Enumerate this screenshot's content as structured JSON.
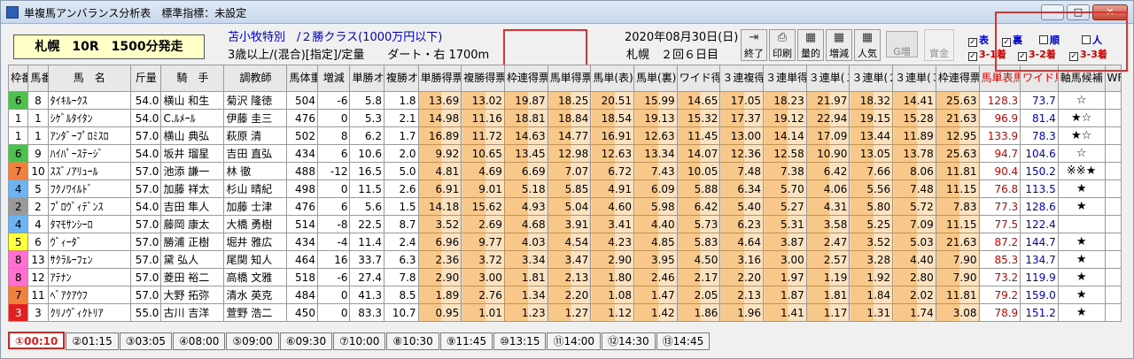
{
  "window": {
    "title": "単複馬アンバランス分析表　標準指標：未設定"
  },
  "race": {
    "box": "札幌　10R　1500分発走",
    "name": "苫小牧特別　/２勝クラス(1000万円以下)",
    "cond": "3歳以上/(混合)[指定]/定量　　ダート・右 1700m",
    "date": "2020年08月30日(日)",
    "venue": "札幌　２回６日目"
  },
  "toolbar": {
    "buttons": [
      {
        "label": "終了",
        "icon": "exit-icon"
      },
      {
        "label": "印刷",
        "icon": "printer-icon"
      },
      {
        "label": "量的",
        "icon": "table-icon"
      },
      {
        "label": "増減",
        "icon": "table-icon"
      },
      {
        "label": "人気",
        "icon": "table-icon"
      }
    ],
    "g_label": "G増",
    "pay_label": "實金"
  },
  "checks": [
    {
      "label": "表",
      "checked": true,
      "color": "blue"
    },
    {
      "label": "裏",
      "checked": true,
      "color": "blue"
    },
    {
      "label": "順",
      "checked": false,
      "color": "blue"
    },
    {
      "label": "人",
      "checked": false,
      "color": "blue"
    },
    {
      "label": "3-1着",
      "checked": true,
      "color": "red"
    },
    {
      "label": "3-2着",
      "checked": true,
      "color": "red"
    },
    {
      "label": "3-3着",
      "checked": true,
      "color": "red"
    }
  ],
  "headers": [
    "枠番",
    "馬番",
    "馬　名",
    "斤量",
    "騎　手",
    "調教師",
    "馬体重",
    "増減",
    "単勝オッズ",
    "複勝オッズ",
    "単勝得票率",
    "複勝得票率",
    "枠連得票率",
    "馬単得票率",
    "馬単(表)",
    "馬単(裏)",
    "ワイド得票率",
    "３連複得票率",
    "３連単得票率",
    "３連単(１着)",
    "３連単(２着)",
    "３連単(３着)",
    "枠連得票率",
    "馬単表馬単裏",
    "ワイド馬連",
    "軸馬候補",
    "WF"
  ],
  "rows": [
    {
      "waku": "6",
      "wc": "#4fbf4f",
      "ban": "8",
      "name": "ﾀｲｷﾙｰｸｽ",
      "kin": "54.0",
      "jockey": "横山 和生",
      "trainer": "菊沢 隆徳",
      "w": "504",
      "d": "-6",
      "o1": "5.8",
      "o2": "1.8",
      "v": [
        "13.69",
        "13.02",
        "19.87",
        "18.25",
        "20.51",
        "15.99",
        "14.65",
        "17.05",
        "18.23",
        "21.97",
        "18.32",
        "14.41",
        "25.63"
      ],
      "b1": "128.3",
      "b2": "73.7",
      "star": "☆"
    },
    {
      "waku": "1",
      "wc": "#ffffff",
      "ban": "1",
      "name": "ｼｹﾞﾙﾀｲﾀﾝ",
      "kin": "54.0",
      "jockey": "C.ﾙﾒｰﾙ",
      "trainer": "伊藤 圭三",
      "w": "476",
      "d": "0",
      "o1": "5.3",
      "o2": "2.1",
      "v": [
        "14.98",
        "11.16",
        "18.81",
        "18.84",
        "18.54",
        "19.13",
        "15.32",
        "17.37",
        "19.12",
        "22.94",
        "19.15",
        "15.28",
        "21.63"
      ],
      "b1": "96.9",
      "b2": "81.4",
      "star": "★☆"
    },
    {
      "waku": "1",
      "wc": "#ffffff",
      "ban": "1",
      "name": "ｱﾝﾀﾞｰﾌﾟﾛﾐｽﾛ",
      "kin": "57.0",
      "jockey": "横山 典弘",
      "trainer": "萩原 清",
      "w": "502",
      "d": "8",
      "o1": "6.2",
      "o2": "1.7",
      "v": [
        "16.89",
        "11.72",
        "14.63",
        "14.77",
        "16.91",
        "12.63",
        "11.45",
        "13.00",
        "14.14",
        "17.09",
        "13.44",
        "11.89",
        "12.95"
      ],
      "b1": "133.9",
      "b2": "78.3",
      "star": "★☆"
    },
    {
      "waku": "6",
      "wc": "#4fbf4f",
      "ban": "9",
      "name": "ﾊｲﾊﾟｰｽﾃｰｼﾞ",
      "kin": "54.0",
      "jockey": "坂井 瑠星",
      "trainer": "吉田 直弘",
      "w": "434",
      "d": "6",
      "o1": "10.6",
      "o2": "2.0",
      "v": [
        "9.92",
        "10.65",
        "13.45",
        "12.98",
        "12.63",
        "13.34",
        "14.07",
        "12.36",
        "12.58",
        "10.90",
        "13.05",
        "13.78",
        "25.63"
      ],
      "b1": "94.7",
      "b2": "104.6",
      "star": "☆"
    },
    {
      "waku": "7",
      "wc": "#f08040",
      "ban": "10",
      "name": "ｽｽﾞﾉｱﾘｭｰﾙ",
      "kin": "57.0",
      "jockey": "池添 謙一",
      "trainer": "林 徹",
      "w": "488",
      "d": "-12",
      "o1": "16.5",
      "o2": "5.0",
      "v": [
        "4.81",
        "4.69",
        "6.69",
        "7.07",
        "6.72",
        "7.43",
        "10.05",
        "7.48",
        "7.38",
        "6.42",
        "7.66",
        "8.06",
        "11.81"
      ],
      "b1": "90.4",
      "b2": "150.2",
      "star": "※※★"
    },
    {
      "waku": "4",
      "wc": "#6fb4f0",
      "ban": "5",
      "name": "ﾌｸﾉﾜｲﾙﾄﾞ",
      "kin": "57.0",
      "jockey": "加藤 祥太",
      "trainer": "杉山 晴紀",
      "w": "498",
      "d": "0",
      "o1": "11.5",
      "o2": "2.6",
      "v": [
        "6.91",
        "9.01",
        "5.18",
        "5.85",
        "4.91",
        "6.09",
        "5.88",
        "6.34",
        "5.70",
        "4.06",
        "5.56",
        "7.48",
        "11.15"
      ],
      "b1": "76.8",
      "b2": "113.5",
      "star": "★"
    },
    {
      "waku": "2",
      "wc": "#9a9a9a",
      "ban": "2",
      "name": "ﾌﾟﾛｳﾞｨﾃﾞﾝｽ",
      "kin": "54.0",
      "jockey": "吉田 隼人",
      "trainer": "加藤 士津",
      "w": "476",
      "d": "6",
      "o1": "5.6",
      "o2": "1.5",
      "v": [
        "14.18",
        "15.62",
        "4.93",
        "5.04",
        "4.60",
        "5.98",
        "6.42",
        "5.40",
        "5.27",
        "4.31",
        "5.80",
        "5.72",
        "7.83"
      ],
      "b1": "77.3",
      "b2": "128.6",
      "star": "★"
    },
    {
      "waku": "4",
      "wc": "#6fb4f0",
      "ban": "4",
      "name": "ﾀﾏﾓｻﾝｼｰﾛ",
      "kin": "57.0",
      "jockey": "藤岡 康太",
      "trainer": "大橋 勇樹",
      "w": "514",
      "d": "-8",
      "o1": "22.5",
      "o2": "8.7",
      "v": [
        "3.52",
        "2.69",
        "4.68",
        "3.91",
        "3.41",
        "4.40",
        "5.73",
        "6.23",
        "5.31",
        "3.58",
        "5.25",
        "7.09",
        "11.15"
      ],
      "b1": "77.5",
      "b2": "122.4",
      "star": ""
    },
    {
      "waku": "5",
      "wc": "#ffff40",
      "ban": "6",
      "name": "ｳﾞｨｰﾀﾞ",
      "kin": "57.0",
      "jockey": "勝浦 正樹",
      "trainer": "堀井 雅広",
      "w": "434",
      "d": "-4",
      "o1": "11.4",
      "o2": "2.4",
      "v": [
        "6.96",
        "9.77",
        "4.03",
        "4.54",
        "4.23",
        "4.85",
        "5.83",
        "4.64",
        "3.87",
        "2.47",
        "3.52",
        "5.03",
        "21.63"
      ],
      "b1": "87.2",
      "b2": "144.7",
      "star": "★"
    },
    {
      "waku": "8",
      "wc": "#ff70d0",
      "ban": "13",
      "name": "ｻｸﾗﾙｰﾌｪﾝ",
      "kin": "57.0",
      "jockey": "黛 弘人",
      "trainer": "尾関 知人",
      "w": "464",
      "d": "16",
      "o1": "33.7",
      "o2": "6.3",
      "v": [
        "2.36",
        "3.72",
        "3.34",
        "3.47",
        "2.90",
        "3.95",
        "4.50",
        "3.16",
        "3.00",
        "2.57",
        "3.28",
        "4.40",
        "7.90"
      ],
      "b1": "85.3",
      "b2": "134.7",
      "star": "★"
    },
    {
      "waku": "8",
      "wc": "#ff70d0",
      "ban": "12",
      "name": "ｱﾃﾅﾝ",
      "kin": "57.0",
      "jockey": "菱田 裕二",
      "trainer": "高橋 文雅",
      "w": "518",
      "d": "-6",
      "o1": "27.4",
      "o2": "7.8",
      "v": [
        "2.90",
        "3.00",
        "1.81",
        "2.13",
        "1.80",
        "2.46",
        "2.17",
        "2.20",
        "1.97",
        "1.19",
        "1.92",
        "2.80",
        "7.90"
      ],
      "b1": "73.2",
      "b2": "119.9",
      "star": "★"
    },
    {
      "waku": "7",
      "wc": "#f08040",
      "ban": "11",
      "name": "ﾍﾞｱｸｱｳﾌ",
      "kin": "57.0",
      "jockey": "大野 拓弥",
      "trainer": "清水 英克",
      "w": "484",
      "d": "0",
      "o1": "41.3",
      "o2": "8.5",
      "v": [
        "1.89",
        "2.76",
        "1.34",
        "2.20",
        "1.08",
        "1.47",
        "2.05",
        "2.13",
        "1.87",
        "1.81",
        "1.84",
        "2.02",
        "11.81"
      ],
      "b1": "79.2",
      "b2": "159.0",
      "star": "★"
    },
    {
      "waku": "3",
      "wc": "#e02020",
      "ban": "3",
      "name": "ｸﾘﾉｳﾞｨｸﾄﾘｱ",
      "kin": "55.0",
      "jockey": "古川 吉洋",
      "trainer": "萱野 浩二",
      "w": "450",
      "d": "0",
      "o1": "83.3",
      "o2": "10.7",
      "v": [
        "0.95",
        "1.01",
        "1.23",
        "1.27",
        "1.12",
        "1.42",
        "1.86",
        "1.96",
        "1.41",
        "1.17",
        "1.31",
        "1.74",
        "3.08"
      ],
      "b1": "78.9",
      "b2": "151.2",
      "star": "★"
    }
  ],
  "tabs": [
    "①00:10",
    "②01:15",
    "③03:05",
    "④08:00",
    "⑤09:00",
    "⑥09:30",
    "⑦10:00",
    "⑧10:30",
    "⑨11:45",
    "⑩13:15",
    "⑪14:00",
    "⑫14:30",
    "⑬14:45"
  ]
}
